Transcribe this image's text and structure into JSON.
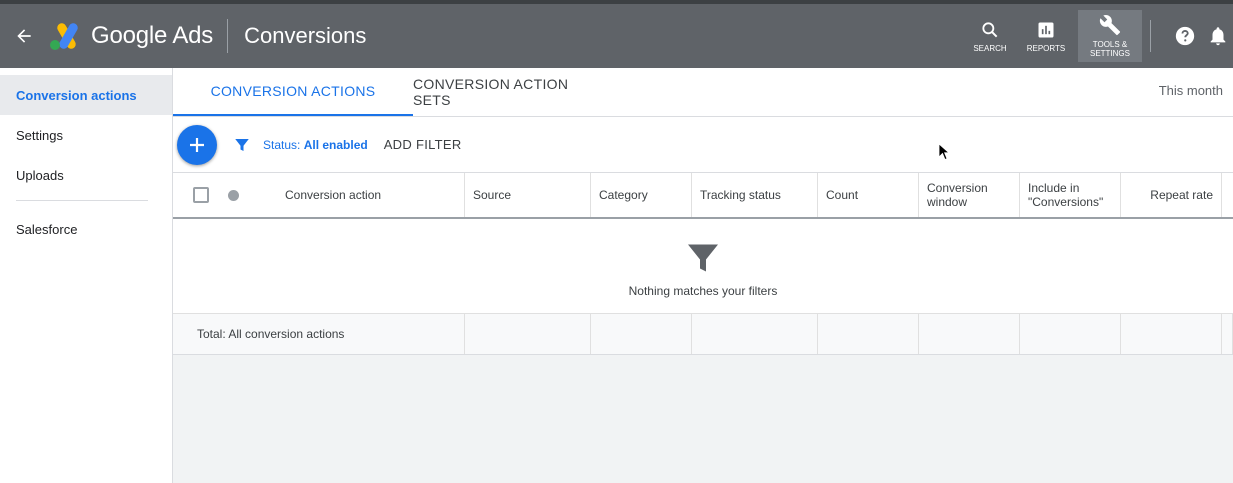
{
  "header": {
    "brand": "Google Ads",
    "page_title": "Conversions",
    "actions": [
      {
        "label": "SEARCH",
        "icon": "search-icon"
      },
      {
        "label": "REPORTS",
        "icon": "reports-icon"
      },
      {
        "label": "TOOLS & SETTINGS",
        "icon": "wrench-icon"
      }
    ]
  },
  "sidebar": {
    "items": [
      {
        "label": "Conversion actions"
      },
      {
        "label": "Settings"
      },
      {
        "label": "Uploads"
      },
      {
        "label": "Salesforce"
      }
    ]
  },
  "tabs": [
    {
      "label": "CONVERSION ACTIONS"
    },
    {
      "label": "CONVERSION ACTION SETS"
    }
  ],
  "date_range": "This month",
  "toolbar": {
    "status_prefix": "Status: ",
    "status_value": "All enabled",
    "add_filter": "ADD FILTER"
  },
  "table": {
    "columns": [
      "Conversion action",
      "Source",
      "Category",
      "Tracking status",
      "Count",
      "Conversion window",
      "Include in \"Conversions\"",
      "Repeat rate"
    ],
    "empty_message": "Nothing matches your filters",
    "total_label": "Total: All conversion actions"
  },
  "colors": {
    "header_bg": "#5f6368",
    "accent": "#1a73e8"
  }
}
